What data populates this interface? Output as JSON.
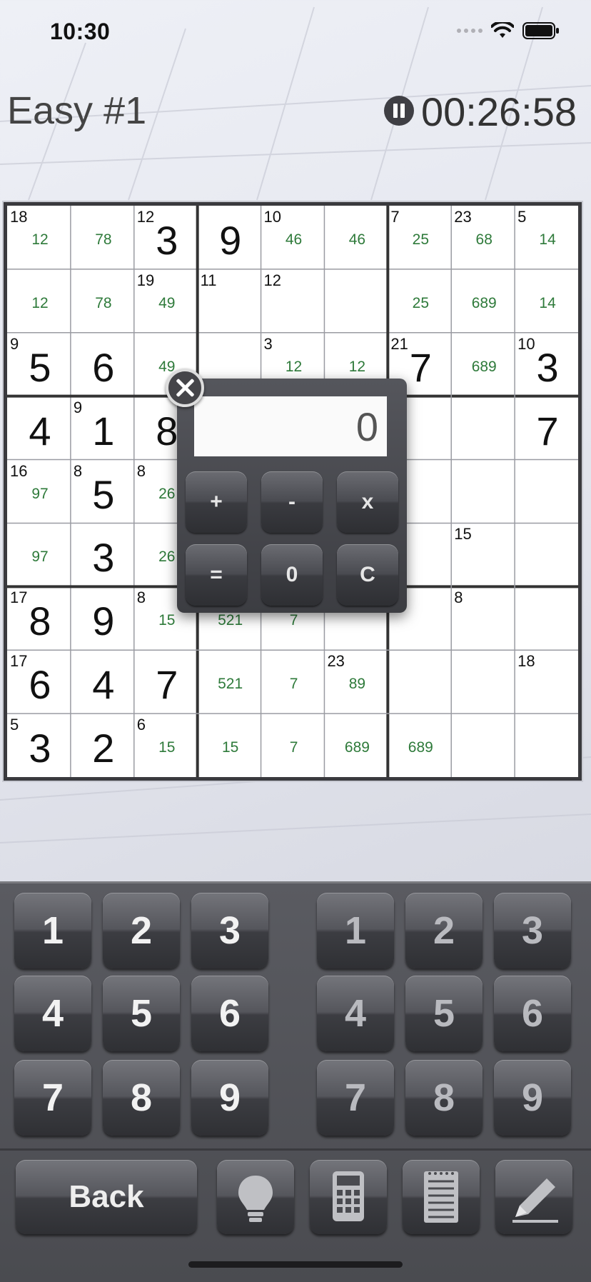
{
  "status_bar": {
    "time": "10:30"
  },
  "header": {
    "title": "Easy #1",
    "timer": "00:26:58"
  },
  "board": {
    "cells": [
      {
        "r": 0,
        "c": 0,
        "sum": "18",
        "cand": "12"
      },
      {
        "r": 0,
        "c": 1,
        "cand": "78"
      },
      {
        "r": 0,
        "c": 2,
        "sum": "12",
        "val": "3"
      },
      {
        "r": 0,
        "c": 3,
        "val": "9"
      },
      {
        "r": 0,
        "c": 4,
        "sum": "10",
        "cand": "46"
      },
      {
        "r": 0,
        "c": 5,
        "cand": "46"
      },
      {
        "r": 0,
        "c": 6,
        "sum": "7",
        "cand": "25"
      },
      {
        "r": 0,
        "c": 7,
        "sum": "23",
        "cand": "68"
      },
      {
        "r": 0,
        "c": 8,
        "sum": "5",
        "cand": "14"
      },
      {
        "r": 1,
        "c": 0,
        "cand": "12"
      },
      {
        "r": 1,
        "c": 1,
        "cand": "78"
      },
      {
        "r": 1,
        "c": 2,
        "sum": "19",
        "cand": "49"
      },
      {
        "r": 1,
        "c": 3,
        "sum": "11"
      },
      {
        "r": 1,
        "c": 4,
        "sum": "12"
      },
      {
        "r": 1,
        "c": 6,
        "cand": "25"
      },
      {
        "r": 1,
        "c": 7,
        "cand": "689"
      },
      {
        "r": 1,
        "c": 8,
        "cand": "14"
      },
      {
        "r": 2,
        "c": 0,
        "sum": "9",
        "val": "5"
      },
      {
        "r": 2,
        "c": 1,
        "val": "6"
      },
      {
        "r": 2,
        "c": 2,
        "cand": "49"
      },
      {
        "r": 2,
        "c": 4,
        "sum": "3",
        "cand": "12"
      },
      {
        "r": 2,
        "c": 5,
        "cand": "12"
      },
      {
        "r": 2,
        "c": 6,
        "sum": "21",
        "val": "7"
      },
      {
        "r": 2,
        "c": 7,
        "cand": "689"
      },
      {
        "r": 2,
        "c": 8,
        "sum": "10",
        "val": "3"
      },
      {
        "r": 3,
        "c": 0,
        "val": "4"
      },
      {
        "r": 3,
        "c": 1,
        "sum": "9",
        "val": "1"
      },
      {
        "r": 3,
        "c": 2,
        "val": "8"
      },
      {
        "r": 3,
        "c": 8,
        "val": "7"
      },
      {
        "r": 4,
        "c": 0,
        "sum": "16",
        "cand": "97"
      },
      {
        "r": 4,
        "c": 1,
        "sum": "8",
        "val": "5"
      },
      {
        "r": 4,
        "c": 2,
        "sum": "8",
        "cand": "26"
      },
      {
        "r": 4,
        "c": 6,
        "sum": "3"
      },
      {
        "r": 5,
        "c": 0,
        "cand": "97"
      },
      {
        "r": 5,
        "c": 1,
        "val": "3"
      },
      {
        "r": 5,
        "c": 2,
        "cand": "26"
      },
      {
        "r": 5,
        "c": 7,
        "sum": "15"
      },
      {
        "r": 6,
        "c": 0,
        "sum": "17",
        "val": "8"
      },
      {
        "r": 6,
        "c": 1,
        "val": "9"
      },
      {
        "r": 6,
        "c": 2,
        "sum": "8",
        "cand": "15"
      },
      {
        "r": 6,
        "c": 3,
        "cand": "521"
      },
      {
        "r": 6,
        "c": 4,
        "cand": "7"
      },
      {
        "r": 6,
        "c": 7,
        "sum": "8"
      },
      {
        "r": 7,
        "c": 0,
        "sum": "17",
        "val": "6"
      },
      {
        "r": 7,
        "c": 1,
        "val": "4"
      },
      {
        "r": 7,
        "c": 2,
        "val": "7"
      },
      {
        "r": 7,
        "c": 3,
        "cand": "521"
      },
      {
        "r": 7,
        "c": 4,
        "cand": "7"
      },
      {
        "r": 7,
        "c": 5,
        "sum": "23",
        "cand": "89"
      },
      {
        "r": 7,
        "c": 8,
        "sum": "18"
      },
      {
        "r": 8,
        "c": 0,
        "sum": "5",
        "val": "3"
      },
      {
        "r": 8,
        "c": 1,
        "val": "2"
      },
      {
        "r": 8,
        "c": 2,
        "sum": "6",
        "cand": "15"
      },
      {
        "r": 8,
        "c": 3,
        "cand": "15"
      },
      {
        "r": 8,
        "c": 4,
        "cand": "7"
      },
      {
        "r": 8,
        "c": 5,
        "cand": "689"
      },
      {
        "r": 8,
        "c": 6,
        "cand": "689"
      }
    ]
  },
  "calculator": {
    "display": "0",
    "keys": [
      "+",
      "-",
      "x",
      "=",
      "0",
      "C"
    ]
  },
  "keypad": {
    "solve_keys": [
      "1",
      "2",
      "3",
      "4",
      "5",
      "6",
      "7",
      "8",
      "9"
    ],
    "note_keys": [
      "1",
      "2",
      "3",
      "4",
      "5",
      "6",
      "7",
      "8",
      "9"
    ]
  },
  "toolbar": {
    "back_label": "Back",
    "icons": [
      "lightbulb-icon",
      "calculator-icon",
      "notepad-icon",
      "pencil-icon"
    ]
  }
}
